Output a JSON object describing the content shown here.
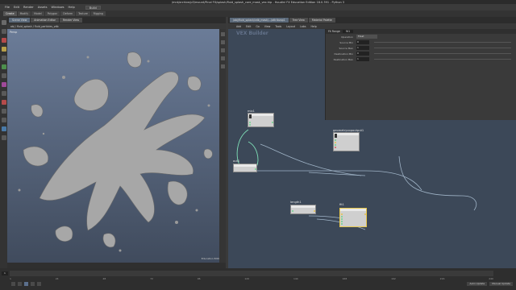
{
  "window": {
    "title": "/mnt/archive/p3/mount/Final FX/splash/fluid_splash_core_mask_vex.hip - Houdini FX Education Edition 18.0.391 - Python 3"
  },
  "menubar": {
    "items": [
      "File",
      "Edit",
      "Render",
      "Assets",
      "Windows",
      "Help"
    ],
    "desktop": "Build"
  },
  "shelf_tabs": [
    "Create",
    "Modify",
    "Model",
    "Polygon",
    "Deform",
    "Texture",
    "Rigging"
  ],
  "viewport": {
    "tabs": [
      "Scene View",
      "Animation Editor",
      "Render View"
    ],
    "path": "obj / fluid_splash / fluid_particles_vdb",
    "label": "Persp",
    "edu": "Education Edition"
  },
  "network": {
    "tabs": [
      "/obj/fluid_splash/vdb_mask/.../attribvop1",
      "Tree View",
      "Material Palette"
    ],
    "menu": [
      "Add",
      "Edit",
      "Go",
      "View",
      "Tools",
      "Layout",
      "Labs",
      "Help"
    ],
    "watermark": "VEX Builder"
  },
  "params": {
    "node_name": "fit1",
    "node_type": "Fit Range",
    "rows": [
      {
        "label": "Operation",
        "type": "select",
        "value": "Float"
      },
      {
        "label": "Source Min",
        "type": "num",
        "value": "0"
      },
      {
        "label": "Source Max",
        "type": "num",
        "value": "1"
      },
      {
        "label": "Destination Min",
        "type": "num",
        "value": "0"
      },
      {
        "label": "Destination Max",
        "type": "num",
        "value": "1"
      }
    ]
  },
  "nodes": {
    "mix1": "mix1",
    "geometryvopoutput1": "geometryvopoutput1",
    "out1": "out1",
    "length1": "length1",
    "fit1": "fit1",
    "out1_label": "v"
  },
  "timeline": {
    "current_frame": "1",
    "ticks": [
      "1",
      "24",
      "48",
      "72",
      "96",
      "120",
      "144",
      "168",
      "192",
      "216",
      "240"
    ],
    "right_buttons": [
      "Auto Update",
      "Manual Update"
    ]
  }
}
